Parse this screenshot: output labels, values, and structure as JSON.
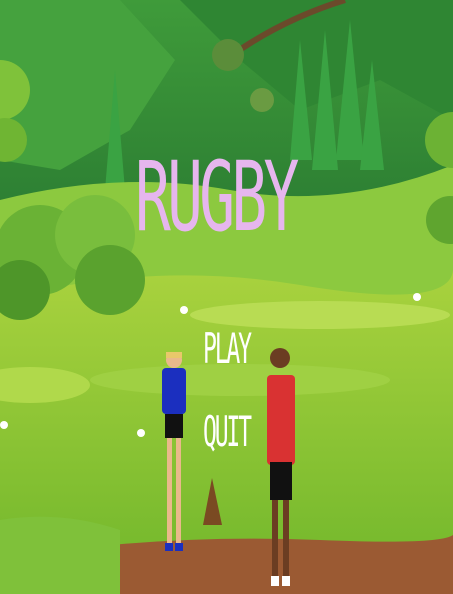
{
  "game": {
    "title": "RUGBY",
    "menu": {
      "play_label": "PLAY",
      "quit_label": "QUIT"
    }
  },
  "colors": {
    "title": "#e6b6ee",
    "menu_text": "#ffffff",
    "player_left_shirt": "#1b2fbf",
    "player_right_shirt": "#d93232",
    "grass": "#8fc832",
    "sky_hills": "#2f8a36"
  }
}
